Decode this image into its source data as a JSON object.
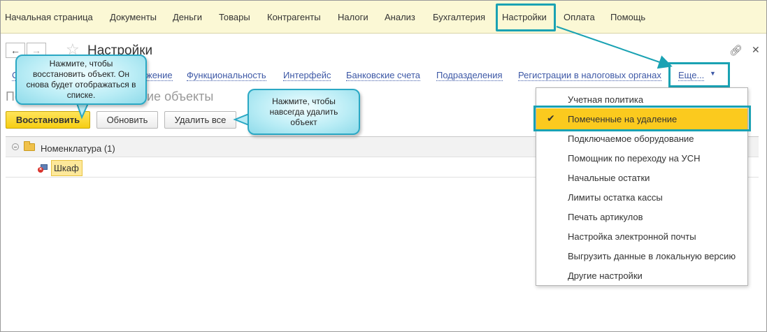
{
  "menu": {
    "items": [
      "Начальная страница",
      "Документы",
      "Деньги",
      "Товары",
      "Контрагенты",
      "Налоги",
      "Анализ",
      "Бухгалтерия",
      "Настройки",
      "Оплата",
      "Помощь"
    ]
  },
  "window": {
    "title": "Настройки"
  },
  "sections": {
    "links": [
      "Функциональность",
      "Интерфейс",
      "Банковские счета",
      "Подразделения",
      "Регистрации в налоговых органах"
    ],
    "partial_link": "жение",
    "partial_first": "С",
    "more_label": "Еще..."
  },
  "page": {
    "subtitle_left": "По",
    "subtitle_right": "ие объекты"
  },
  "toolbar": {
    "restore_label": "Восстановить",
    "refresh_label": "Обновить",
    "delete_all_label": "Удалить все"
  },
  "tree": {
    "group_label": "Номенклатура (1)",
    "item_label": "Шкаф"
  },
  "dropdown": {
    "items": [
      "Учетная политика",
      "Помеченные на удаление",
      "Подключаемое оборудование",
      "Помощник по переходу на УСН",
      "Начальные остатки",
      "Лимиты остатка кассы",
      "Печать артикулов",
      "Настройка электронной почты",
      "Выгрузить данные в локальную версию",
      "Другие настройки"
    ],
    "selected_index": 1
  },
  "callouts": {
    "restore": "Нажмите, чтобы восстановить объект. Он снова будет отображаться в списке.",
    "delete": "Нажмите, чтобы навсегда удалить объект"
  },
  "colors": {
    "menu_bg": "#fbf8d5",
    "accent_highlight": "#1aa2b3",
    "link": "#3d58a6",
    "primary_button": "#f6cd13",
    "selection": "#fbca1e"
  },
  "icons": {
    "back": "arrow-left-icon",
    "forward": "arrow-right-icon",
    "favorite": "star-icon",
    "link": "link-icon",
    "close": "close-icon",
    "collapse": "collapse-icon",
    "folder": "folder-icon",
    "deleted_item": "marked-deleted-icon",
    "check": "check-icon",
    "caret": "caret-down-icon"
  }
}
